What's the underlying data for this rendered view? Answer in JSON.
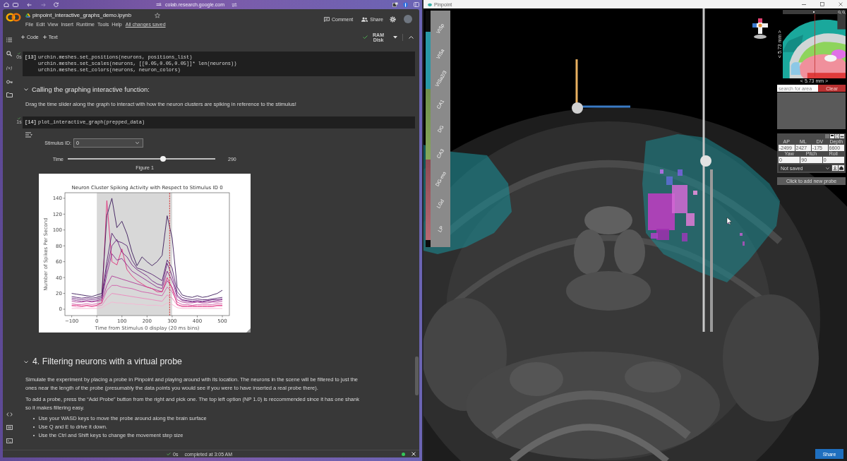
{
  "browser": {
    "url": "colab.research.google.com"
  },
  "notebook": {
    "title": "pinpoint_interactive_graphs_demo.ipynb",
    "starred": false,
    "menu": [
      "File",
      "Edit",
      "View",
      "Insert",
      "Runtime",
      "Tools",
      "Help"
    ],
    "save_status": "All changes saved",
    "comment_button": "Comment",
    "share_button": "Share"
  },
  "toolbar": {
    "buttons": [
      "Code",
      "Text"
    ],
    "ram_label": "RAM",
    "disk_label": "Disk"
  },
  "sidebar": {
    "variables_label": "{x}"
  },
  "cells": [
    {
      "kind": "code",
      "run_time": "0s",
      "prompt": "[13]",
      "lines": [
        "urchin.meshes.set_positions(neurons, positions_list)",
        "urchin.meshes.set_scales(neurons, [[0.05,0.05,0.05]]* len(neurons))",
        "urchin.meshes.set_colors(neurons, neuron_colors)"
      ]
    },
    {
      "kind": "subheading",
      "expanded": true,
      "text": "Calling the graphing interactive function:"
    },
    {
      "kind": "paragraph",
      "text": "Drag the time slider along the graph to interact with how the neuron clusters are spiking in reference to the stimulus!"
    },
    {
      "kind": "code",
      "run_time": "1s",
      "prompt": "[14]",
      "lines": [
        "plot_interactive_graph(prepped_data)"
      ]
    },
    {
      "kind": "output",
      "controls": [
        {
          "kind": "dropdown",
          "label": "Stimulus ID:",
          "value": "0"
        },
        {
          "kind": "slider",
          "label": "Time",
          "level": 0.65,
          "reading": "290"
        }
      ],
      "figure": {
        "caption": "Figure 1",
        "chart_data": {
          "type": "line",
          "title": "Neuron Cluster Spiking Activity with Respect to Stimulus ID 0",
          "xlabel": "Time from Stimulus 0 display (20 ms bins)",
          "ylabel": "Number of Spikes Per Second",
          "x": [
            -100,
            -80,
            -60,
            -40,
            -20,
            0,
            20,
            40,
            60,
            80,
            100,
            120,
            140,
            160,
            180,
            200,
            220,
            240,
            260,
            280,
            300,
            320,
            340,
            360,
            380,
            400,
            420,
            440,
            460,
            480,
            500
          ],
          "series": [
            {
              "color": "#3b1a5a",
              "values": [
                20,
                19,
                18,
                17,
                16,
                18,
                20,
                118,
                140,
                103,
                111,
                95,
                72,
                55,
                66,
                60,
                55,
                60,
                68,
                118,
                90,
                28,
                18,
                16,
                15,
                17,
                15,
                16,
                18,
                20,
                24
              ]
            },
            {
              "color": "#55206e",
              "values": [
                16,
                15,
                14,
                15,
                14,
                15,
                17,
                60,
                96,
                86,
                84,
                80,
                62,
                52,
                50,
                47,
                44,
                40,
                36,
                62,
                52,
                22,
                15,
                13,
                12,
                13,
                12,
                12,
                13,
                14,
                15
              ]
            },
            {
              "color": "#6e2480",
              "values": [
                14,
                13,
                12,
                13,
                12,
                13,
                15,
                52,
                80,
                88,
                72,
                66,
                56,
                50,
                46,
                42,
                36,
                32,
                30,
                58,
                42,
                18,
                12,
                11,
                10,
                11,
                10,
                11,
                12,
                12,
                13
              ]
            },
            {
              "color": "#8a2c8c",
              "values": [
                12,
                11,
                10,
                11,
                10,
                11,
                13,
                44,
                70,
                62,
                64,
                56,
                48,
                44,
                40,
                36,
                32,
                28,
                26,
                48,
                36,
                16,
                11,
                10,
                9,
                10,
                9,
                10,
                10,
                11,
                12
              ]
            },
            {
              "color": "#e0307a",
              "values": [
                5,
                5,
                4,
                5,
                4,
                5,
                8,
                137,
                60,
                56,
                76,
                50,
                42,
                36,
                32,
                28,
                26,
                22,
                22,
                40,
                26,
                6,
                4,
                4,
                4,
                4,
                4,
                4,
                4,
                5,
                5
              ]
            },
            {
              "color": "#b03c96",
              "values": [
                10,
                9,
                9,
                10,
                9,
                10,
                11,
                30,
                42,
                40,
                38,
                36,
                34,
                32,
                30,
                28,
                26,
                24,
                22,
                36,
                28,
                12,
                9,
                8,
                8,
                9,
                8,
                8,
                9,
                9,
                10
              ]
            },
            {
              "color": "#d05aa8",
              "values": [
                7,
                6,
                6,
                7,
                6,
                7,
                8,
                24,
                30,
                30,
                28,
                27,
                26,
                24,
                22,
                21,
                20,
                18,
                17,
                28,
                22,
                9,
                6,
                6,
                5,
                6,
                6,
                6,
                6,
                7,
                7
              ]
            },
            {
              "color": "#ec86bc",
              "values": [
                4,
                3,
                3,
                4,
                3,
                4,
                5,
                14,
                20,
                19,
                18,
                17,
                16,
                15,
                14,
                13,
                12,
                11,
                10,
                18,
                14,
                5,
                3,
                3,
                3,
                3,
                3,
                3,
                3,
                4,
                4
              ]
            },
            {
              "color": "#f6b4d2",
              "values": [
                1,
                1,
                1,
                1,
                1,
                1,
                2,
                6,
                9,
                8,
                8,
                7,
                7,
                6,
                6,
                5,
                5,
                5,
                4,
                8,
                6,
                2,
                1,
                1,
                1,
                1,
                1,
                1,
                1,
                1,
                1
              ]
            }
          ],
          "xlim": [
            -127,
            528
          ],
          "ylim": [
            -8,
            147
          ],
          "xticks": [
            {
              "value": -100,
              "label": "−100"
            },
            0,
            100,
            200,
            300,
            400,
            500
          ],
          "yticks": [
            140,
            120,
            100,
            80,
            60,
            40,
            20,
            0
          ],
          "bands": [
            {
              "axis": "x",
              "from": 0,
              "to": 300,
              "color": "#d8d8d8"
            }
          ],
          "ref_lines": [
            {
              "axis": "x",
              "value": 290,
              "color": "#d62728"
            }
          ]
        }
      }
    },
    {
      "kind": "heading",
      "expanded": true,
      "text": "4. Filtering neurons with a virtual probe"
    },
    {
      "kind": "paragraph",
      "text": "Simulate the experiment by placing a probe in Pinpoint and playing around with its location. The neurons in the scene will be filtered to just the ones near the length of the probe (presumably the data points you would see if you were to have inserted a real probe there)."
    },
    {
      "kind": "paragraph",
      "text": "To add a probe, press the “Add Probe” button from the right and pick one. The top left option (NP 1.0) is reccommended since it has one shank so it makes filtering easy."
    },
    {
      "kind": "bullets",
      "items": [
        "Use your WASD keys to move the probe around along the brain surface",
        "Use Q and E to drive it down.",
        "Use the Ctrl and Shift keys to change the movement step size"
      ]
    }
  ],
  "status_bar": {
    "duration": "0s",
    "text": "completed at 3:05 AM"
  },
  "pinpoint": {
    "title": "Pinpoint",
    "area_labels": [
      "VISp",
      "VISa",
      "VISa2/3",
      "CA1",
      "DG",
      "CA3",
      "DG-mo",
      "LGd",
      "LP"
    ],
    "atlas": {
      "width_label": "< 5.73 mm >",
      "height_label": "< 5.73 mm >"
    },
    "area_search": {
      "placeholder": "search for area"
    },
    "clear_button": "Clear",
    "probe": {
      "coordinates": [
        {
          "label": "AP",
          "value": "-2499"
        },
        {
          "label": "ML",
          "value": "2427"
        },
        {
          "label": "DV",
          "value": "-175"
        },
        {
          "label": "Depth",
          "value": "6600"
        }
      ],
      "angles": [
        {
          "label": "Yaw",
          "value": "0"
        },
        {
          "label": "Pitch",
          "value": "90"
        },
        {
          "label": "Roll",
          "value": "0"
        }
      ],
      "save_state": "Not saved"
    },
    "add_probe_button": "Click to add new probe",
    "share_button": "Share"
  }
}
